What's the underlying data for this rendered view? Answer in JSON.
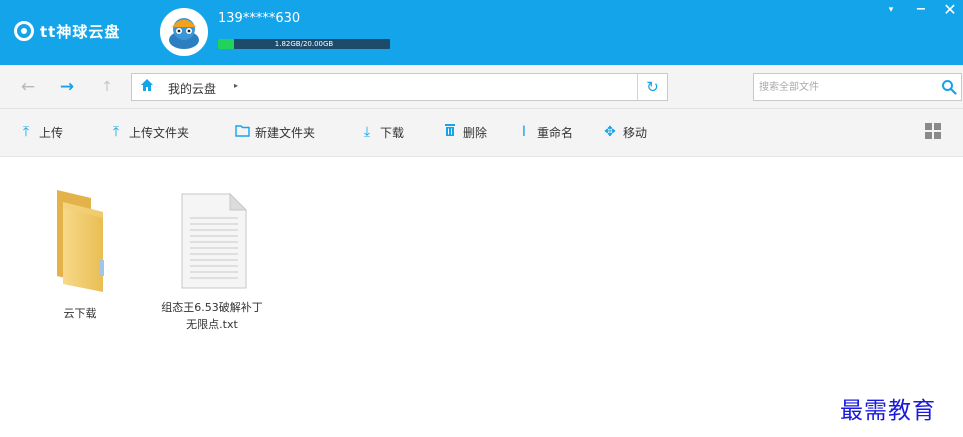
{
  "app": {
    "logo_text": "tt神球云盘",
    "user_name": "139*****630",
    "quota_text": "1.82GB/20.00GB",
    "quota_fraction": 0.091
  },
  "window_controls": {
    "menu": "▾",
    "minimize": "−",
    "close": "✕"
  },
  "nav": {
    "back_glyph": "←",
    "forward_glyph": "→",
    "up_glyph": "↑",
    "breadcrumb": "我的云盘",
    "breadcrumb_arrow": "▸",
    "refresh_glyph": "↻"
  },
  "search": {
    "placeholder": "搜索全部文件"
  },
  "toolbar": {
    "upload": "上传",
    "upload_folder": "上传文件夹",
    "new_folder": "新建文件夹",
    "download": "下载",
    "delete": "删除",
    "rename": "重命名",
    "move": "移动"
  },
  "files": [
    {
      "name": "云下载",
      "type": "folder"
    },
    {
      "name": "组态王6.53破解补丁无限点.txt",
      "type": "txt"
    }
  ],
  "watermark": "最需教育",
  "colors": {
    "accent": "#14a4ea",
    "quota_fill": "#1fd35b",
    "watermark": "#1a1adc"
  }
}
